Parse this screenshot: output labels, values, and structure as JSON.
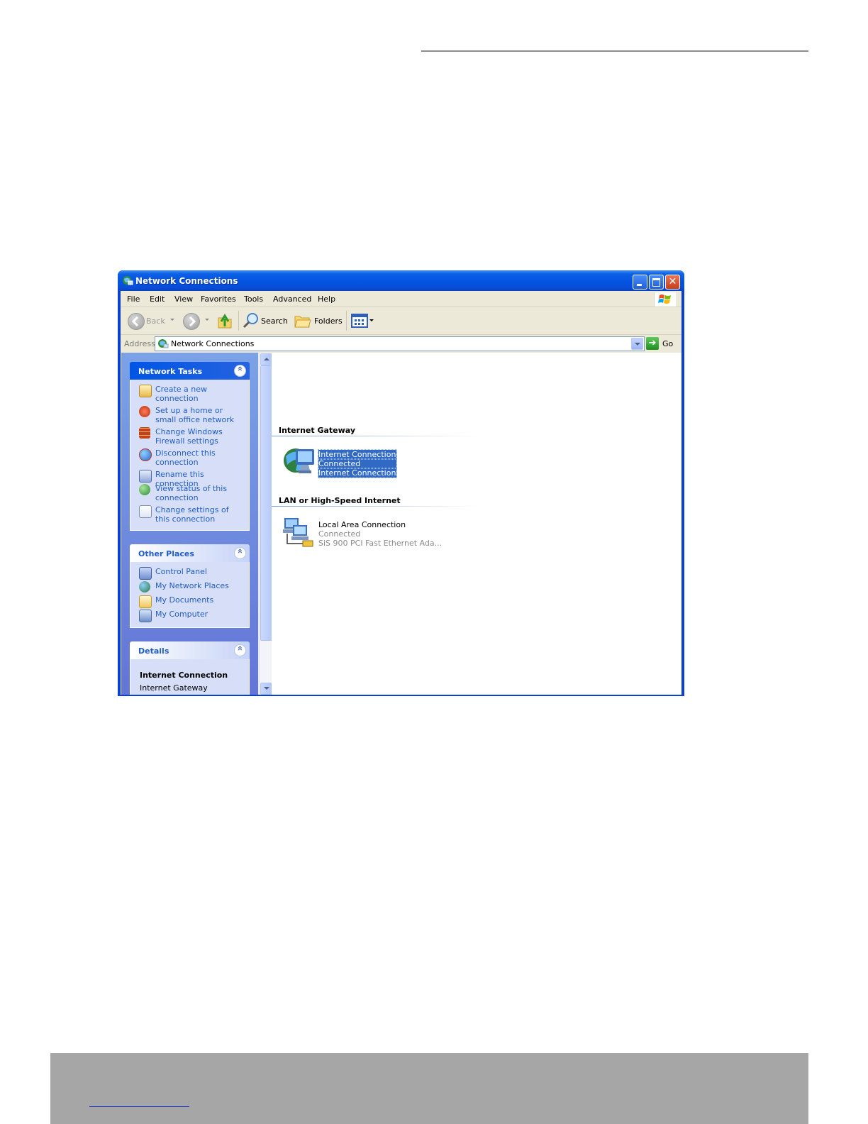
{
  "window": {
    "title": "Network Connections"
  },
  "menu": [
    "File",
    "Edit",
    "View",
    "Favorites",
    "Tools",
    "Advanced",
    "Help"
  ],
  "toolbar": {
    "back_label": "Back",
    "search_label": "Search",
    "folders_label": "Folders"
  },
  "address": {
    "label": "Address",
    "value": "Network Connections",
    "go_label": "Go"
  },
  "network_tasks": {
    "title": "Network Tasks",
    "items": [
      "Create a new connection",
      "Set up a home or small office network",
      "Change Windows Firewall settings",
      "Disconnect this connection",
      "Rename this connection",
      "View status of this connection",
      "Change settings of this connection"
    ]
  },
  "other_places": {
    "title": "Other Places",
    "items": [
      "Control Panel",
      "My Network Places",
      "My Documents",
      "My Computer"
    ]
  },
  "details": {
    "title": "Details",
    "name": "Internet Connection",
    "type": "Internet Gateway"
  },
  "groups": [
    {
      "header": "Internet Gateway",
      "connection": {
        "name": "Internet Connection",
        "status": "Connected",
        "device": "Internet Connection",
        "selected": true
      }
    },
    {
      "header": "LAN or High-Speed Internet",
      "connection": {
        "name": "Local Area Connection",
        "status": "Connected",
        "device": "SiS 900 PCI Fast Ethernet Ada...",
        "selected": false
      }
    }
  ],
  "colors": {
    "title_bar": "#0454e3",
    "task_pane": "#7ba2e7",
    "link": "#215dc6",
    "selection": "#316ac5"
  }
}
